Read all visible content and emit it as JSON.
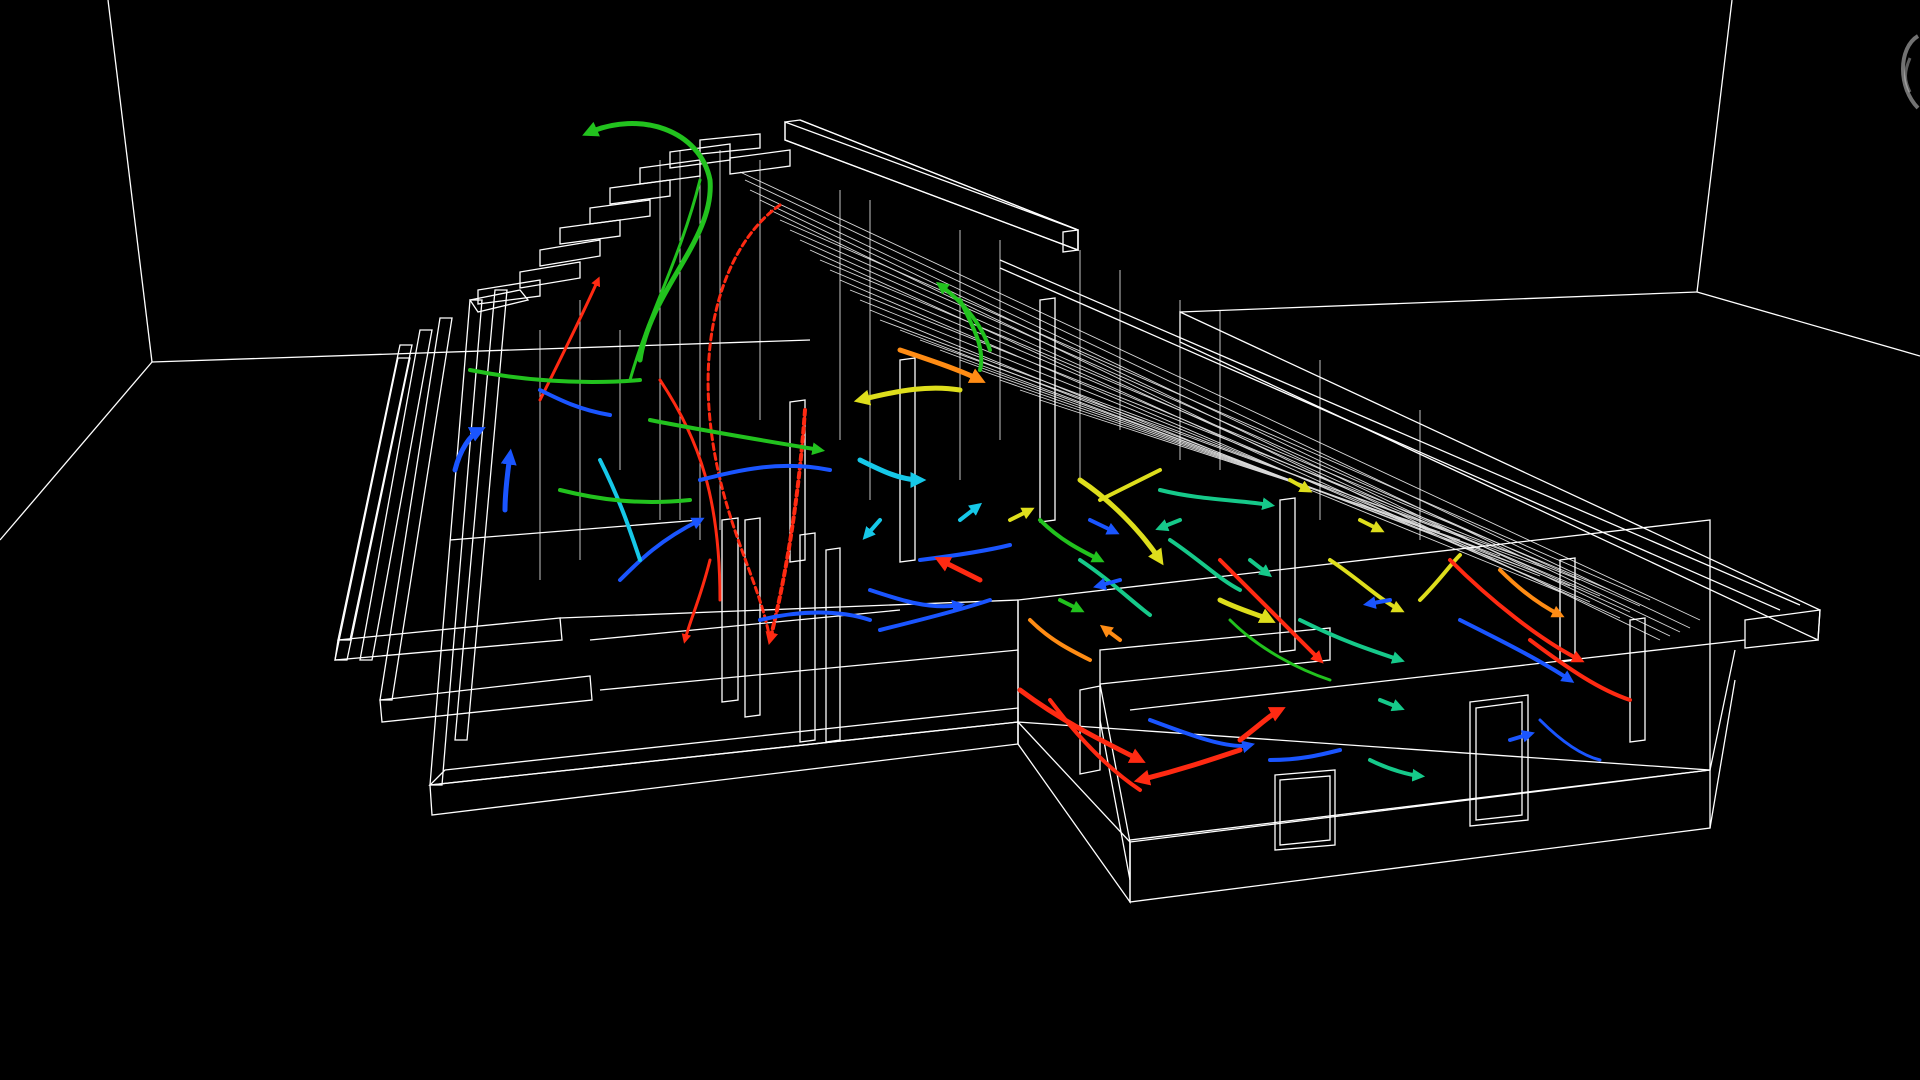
{
  "scene": {
    "background": "#000000",
    "wireframe_color": "#ffffff",
    "flow_palette": {
      "slow": "#1a55ff",
      "cyan": "#16c8e8",
      "teal": "#16c98a",
      "green": "#22c21e",
      "yellow": "#dede1c",
      "orange": "#ff8c14",
      "fast": "#ff2a12"
    },
    "icons": [
      "orbit-navigation-icon"
    ]
  }
}
